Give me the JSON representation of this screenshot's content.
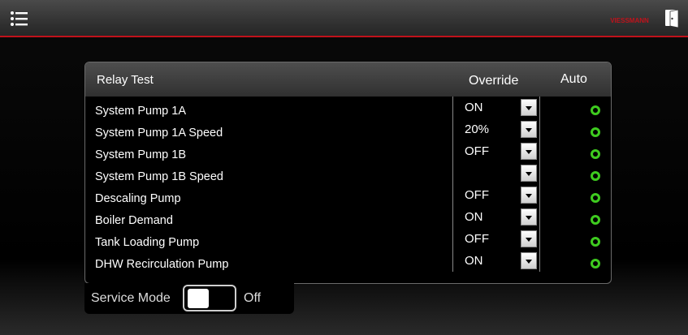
{
  "header": {
    "menu_icon": "list-menu-icon",
    "brand": "VIESSMANN",
    "logout_icon": "door-exit-icon",
    "accent_color": "#c0121b"
  },
  "panel": {
    "title": "Relay Test",
    "col_override": "Override",
    "col_auto": "Auto",
    "rows": [
      {
        "label": "System Pump 1A",
        "override": "ON",
        "auto": "green-ring"
      },
      {
        "label": "System Pump 1A Speed",
        "override": "20%",
        "auto": "green-ring"
      },
      {
        "label": "System Pump 1B",
        "override": "OFF",
        "auto": "green-ring"
      },
      {
        "label": "System Pump 1B Speed",
        "override": "",
        "auto": "green-ring"
      },
      {
        "label": "Descaling Pump",
        "override": "OFF",
        "auto": "green-ring"
      },
      {
        "label": "Boiler Demand",
        "override": "ON",
        "auto": "green-ring"
      },
      {
        "label": "Tank Loading Pump",
        "override": "OFF",
        "auto": "green-ring"
      },
      {
        "label": "DHW Recirculation Pump",
        "override": "ON",
        "auto": "green-ring"
      }
    ],
    "auto_color": "#3ecb1f"
  },
  "service_mode": {
    "label": "Service Mode",
    "state": "Off"
  }
}
